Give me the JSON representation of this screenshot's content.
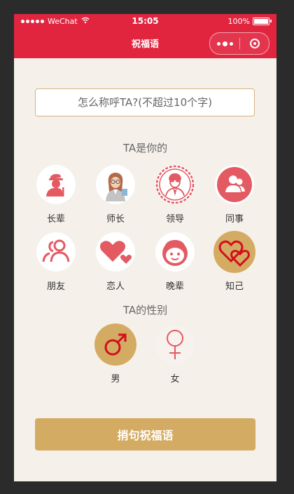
{
  "status_bar": {
    "carrier": "WeChat",
    "time": "15:05",
    "battery": "100%"
  },
  "nav": {
    "title": "祝福语",
    "more_icon": "more-dots-icon",
    "close_icon": "close-circle-icon"
  },
  "form": {
    "name_placeholder": "怎么称呼TA?(不超过10个字)",
    "name_value": ""
  },
  "relation": {
    "title": "TA是你的",
    "options": [
      {
        "label": "长辈",
        "icon": "elder-icon",
        "selected": false
      },
      {
        "label": "师长",
        "icon": "teacher-icon",
        "selected": false
      },
      {
        "label": "领导",
        "icon": "leader-icon",
        "selected": false
      },
      {
        "label": "同事",
        "icon": "colleague-icon",
        "selected": false
      },
      {
        "label": "朋友",
        "icon": "friend-icon",
        "selected": false
      },
      {
        "label": "恋人",
        "icon": "lover-icon",
        "selected": false
      },
      {
        "label": "晚辈",
        "icon": "junior-icon",
        "selected": false
      },
      {
        "label": "知己",
        "icon": "confidant-icon",
        "selected": true
      }
    ]
  },
  "gender": {
    "title": "TA的性别",
    "options": [
      {
        "label": "男",
        "icon": "male-icon",
        "selected": true
      },
      {
        "label": "女",
        "icon": "female-icon",
        "selected": false
      }
    ]
  },
  "submit_label": "捎句祝福语",
  "colors": {
    "brand_red": "#e1253f",
    "accent_gold": "#d4ab62",
    "icon_red": "#e35a63",
    "background": "#f5f1ea"
  }
}
